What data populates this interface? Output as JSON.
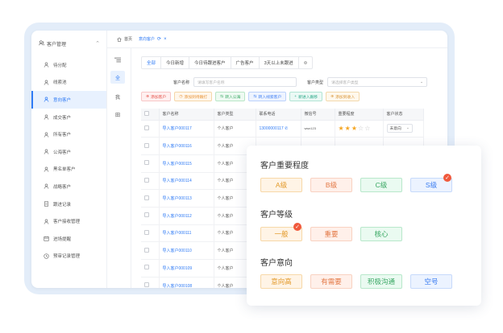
{
  "sidebar": {
    "section": "客户管理",
    "items": [
      {
        "label": "待分配",
        "icon": "user-icon",
        "active": false
      },
      {
        "label": "线索池",
        "icon": "user-icon",
        "active": false
      },
      {
        "label": "意向客户",
        "icon": "user-icon",
        "active": true
      },
      {
        "label": "成交客户",
        "icon": "user-icon",
        "active": false
      },
      {
        "label": "所有客户",
        "icon": "user-icon",
        "active": false
      },
      {
        "label": "公海客户",
        "icon": "user-icon",
        "active": false
      },
      {
        "label": "黑名单客户",
        "icon": "user-icon",
        "active": false
      },
      {
        "label": "战略客户",
        "icon": "user-icon",
        "active": false
      },
      {
        "label": "跟进记录",
        "icon": "document-icon",
        "active": false
      },
      {
        "label": "客户接收管理",
        "icon": "user-icon",
        "active": false
      },
      {
        "label": "进场提醒",
        "icon": "calendar-icon",
        "active": false
      },
      {
        "label": "预审记录管理",
        "icon": "clock-icon",
        "active": false
      }
    ]
  },
  "topbar": {
    "home": "首页",
    "current": "意向客户"
  },
  "iconcol": {
    "a": "全",
    "b": "我",
    "c": "田"
  },
  "tabs": [
    "全部",
    "今日新增",
    "今日待跟进客户",
    "广告客户",
    "3天以上未跟进"
  ],
  "filters": {
    "name_label": "客户名称",
    "name_placeholder": "请填写客户名称",
    "type_label": "客户类型",
    "type_placeholder": "请选择客户类型"
  },
  "actions": [
    {
      "label": "添加客户",
      "style": "a-red",
      "icon": "plus-circle-icon"
    },
    {
      "label": "添加到待跟打",
      "style": "a-orange",
      "icon": "clock-icon"
    },
    {
      "label": "转入公海",
      "style": "a-green",
      "icon": "swap-icon"
    },
    {
      "label": "转入线索客户",
      "style": "a-blue",
      "icon": "swap-icon"
    },
    {
      "label": "新进入跟移",
      "style": "a-teal",
      "icon": "plus-icon"
    },
    {
      "label": "添加到收入",
      "style": "a-gold",
      "icon": "plus-circle-icon"
    }
  ],
  "table": {
    "headers": [
      "客户名称",
      "客户类型",
      "联系电话",
      "微信号",
      "重要程度",
      "客户状态"
    ],
    "rows": [
      {
        "name": "导入客户000117",
        "type": "个人客户",
        "phone": "13000000117",
        "wechat": "wwx123",
        "stars": 3,
        "status": "未意向"
      },
      {
        "name": "导入客户000116",
        "type": "个人客户",
        "phone": "",
        "wechat": "",
        "stars": 0,
        "status": ""
      },
      {
        "name": "导入客户000115",
        "type": "个人客户",
        "phone": "",
        "wechat": "",
        "stars": 0,
        "status": ""
      },
      {
        "name": "导入客户000114",
        "type": "个人客户",
        "phone": "",
        "wechat": "",
        "stars": 0,
        "status": ""
      },
      {
        "name": "导入客户000113",
        "type": "个人客户",
        "phone": "",
        "wechat": "",
        "stars": 0,
        "status": ""
      },
      {
        "name": "导入客户000112",
        "type": "个人客户",
        "phone": "",
        "wechat": "",
        "stars": 0,
        "status": ""
      },
      {
        "name": "导入客户000111",
        "type": "个人客户",
        "phone": "",
        "wechat": "",
        "stars": 0,
        "status": ""
      },
      {
        "name": "导入客户000110",
        "type": "个人客户",
        "phone": "",
        "wechat": "",
        "stars": 0,
        "status": ""
      },
      {
        "name": "导入客户000109",
        "type": "个人客户",
        "phone": "",
        "wechat": "",
        "stars": 0,
        "status": ""
      },
      {
        "name": "导入客户000108",
        "type": "个人客户",
        "phone": "",
        "wechat": "",
        "stars": 0,
        "status": ""
      }
    ]
  },
  "card": {
    "importance": {
      "title": "客户重要程度",
      "tags": [
        "A级",
        "B级",
        "C级",
        "S级"
      ],
      "checked": "S级"
    },
    "level": {
      "title": "客户等级",
      "tags": [
        "一般",
        "重要",
        "核心"
      ],
      "checked": "一般"
    },
    "intent": {
      "title": "客户意向",
      "tags": [
        "意向高",
        "有需要",
        "积极沟通",
        "空号"
      ]
    }
  },
  "colors": {
    "accent": "#2f7bf5",
    "frame": "#e3edf9",
    "star": "#f5a623",
    "check": "#f0593c"
  }
}
